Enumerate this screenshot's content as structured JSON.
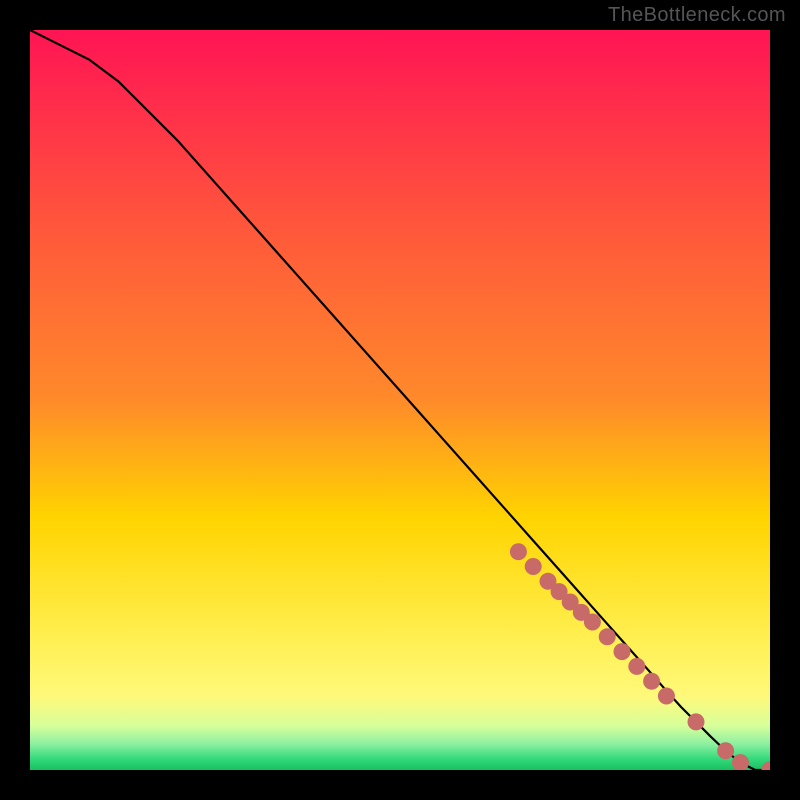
{
  "watermark": "TheBottleneck.com",
  "colors": {
    "background_black": "#000000",
    "gradient_top": "#ff1454",
    "gradient_upper_mid": "#ff8a2a",
    "gradient_mid": "#ffd400",
    "gradient_lower": "#fff97a",
    "gradient_green": "#33d97b",
    "curve_stroke": "#000000",
    "marker_fill": "#c76a68"
  },
  "chart_data": {
    "type": "line",
    "title": "",
    "xlabel": "",
    "ylabel": "",
    "xlim": [
      0,
      100
    ],
    "ylim": [
      0,
      100
    ],
    "series": [
      {
        "name": "curve",
        "x": [
          0,
          4,
          8,
          12,
          16,
          20,
          24,
          28,
          32,
          36,
          40,
          44,
          48,
          52,
          56,
          60,
          64,
          68,
          72,
          76,
          80,
          84,
          86,
          88,
          90,
          92,
          94,
          96,
          98,
          100
        ],
        "y": [
          100,
          98,
          96,
          93,
          89,
          85,
          80.5,
          76,
          71.5,
          67,
          62.5,
          58,
          53.5,
          49,
          44.5,
          40,
          35.5,
          31,
          26.5,
          22,
          17.5,
          13,
          10.7,
          8.5,
          6.5,
          4.5,
          2.6,
          1.0,
          0.0,
          0.0
        ]
      }
    ],
    "markers": {
      "name": "highlighted-points",
      "x": [
        66,
        68,
        70,
        71.5,
        73,
        74.5,
        76,
        78,
        80,
        82,
        84,
        86,
        90,
        94,
        96,
        100
      ],
      "y": [
        29.5,
        27.5,
        25.5,
        24.1,
        22.7,
        21.3,
        20.0,
        18.0,
        16.0,
        14.0,
        12.0,
        10.0,
        6.5,
        2.6,
        1.0,
        0.0
      ]
    }
  }
}
